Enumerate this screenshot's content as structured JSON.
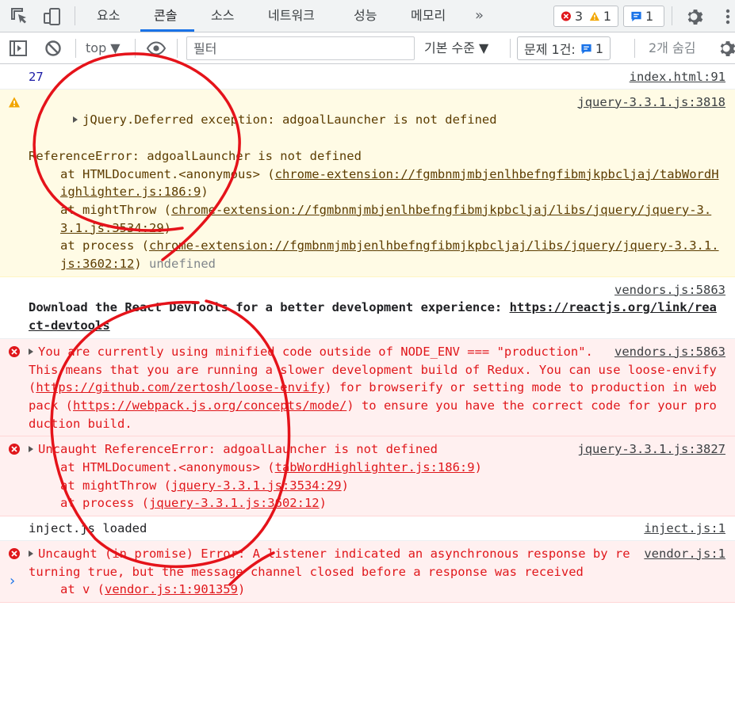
{
  "tabs": [
    {
      "label": "요소"
    },
    {
      "label": "콘솔",
      "active": true
    },
    {
      "label": "소스"
    },
    {
      "label": "네트워크"
    },
    {
      "label": "성능"
    },
    {
      "label": "메모리"
    }
  ],
  "more_tabs": "»",
  "counters": {
    "errors": "3",
    "warnings": "1",
    "messages": "1"
  },
  "toolbar": {
    "context": "top ▼",
    "filter_placeholder": "필터",
    "levels": "기본 수준 ▼",
    "issues_label": "문제 1건:",
    "issues_count": "1",
    "hidden": "2개 숨김"
  },
  "messages": {
    "m1": {
      "value": "27",
      "source": "index.html:91"
    },
    "m2": {
      "source": "jquery-3.3.1.js:3818",
      "header": "jQuery.Deferred exception: adgoalLauncher is not defined",
      "error": "ReferenceError: adgoalLauncher is not defined",
      "s1_prefix": "at HTMLDocument.<anonymous> (",
      "s1_link": "chrome-extension://fgmbnmjmbjenlhbefngfibmjkpbcljaj/tabWordHighlighter.js:186:9",
      "s1_suffix": ")",
      "s2_prefix": "at mightThrow (",
      "s2_link": "chrome-extension://fgmbnmjmbjenlhbefngfibmjkpbcljaj/libs/jquery/jquery-3.3.1.js:3534:29",
      "s2_suffix": ")",
      "s3_prefix": "at process (",
      "s3_link": "chrome-extension://fgmbnmjmbjenlhbefngfibmjkpbcljaj/libs/jquery/jquery-3.3.1.js:3602:12",
      "s3_suffix": ")",
      "tail": "undefined"
    },
    "m3": {
      "source": "vendors.js:5863",
      "text": "Download the React DevTools for a better development experience: ",
      "link": "https://reactjs.org/link/react-devtools"
    },
    "m4": {
      "source": "vendors.js:5863",
      "t1": "You are currently using minified code outside of NODE_ENV === \"production\". This means that you are running a slower development build of Redux. You can use loose-envify (",
      "l1": "https://github.com/zertosh/loose-envify",
      "t2": ") for browserify or setting mode to production in webpack (",
      "l2": "https://webpack.js.org/concepts/mode/",
      "t3": ") to ensure you have the correct code for your production build."
    },
    "m5": {
      "source": "jquery-3.3.1.js:3827",
      "header": "Uncaught ReferenceError: adgoalLauncher is not defined",
      "s1_prefix": "at HTMLDocument.<anonymous> (",
      "s1_link": "tabWordHighlighter.js:186:9",
      "s1_suffix": ")",
      "s2_prefix": "at mightThrow (",
      "s2_link": "jquery-3.3.1.js:3534:29",
      "s2_suffix": ")",
      "s3_prefix": "at process (",
      "s3_link": "jquery-3.3.1.js:3602:12",
      "s3_suffix": ")"
    },
    "m6": {
      "text": "inject.js loaded",
      "source": "inject.js:1"
    },
    "m7": {
      "source": "vendor.js:1",
      "header": "Uncaught (in promise) Error: A listener indicated an asynchronous response by returning true, but the message channel closed before a response was received",
      "s1_prefix": "at v (",
      "s1_link": "vendor.js:1:901359",
      "s1_suffix": ")"
    }
  },
  "prompt": "›",
  "colors": {
    "accent": "#1a73e8",
    "error": "#e0171b",
    "warning_bg": "#fffbe5",
    "error_bg": "#fff0f0",
    "annotation": "#e5131a"
  }
}
